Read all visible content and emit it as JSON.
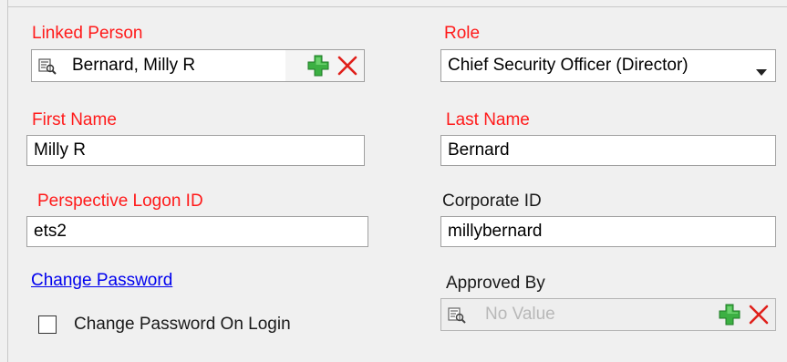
{
  "linked_person": {
    "label": "Linked Person",
    "value": "Bernard, Milly R",
    "add_icon": "green-plus-icon",
    "remove_icon": "red-x-icon",
    "lookup_icon": "lookup-list-icon"
  },
  "role": {
    "label": "Role",
    "selected": "Chief Security Officer (Director)"
  },
  "first_name": {
    "label": "First Name",
    "value": "Milly R"
  },
  "last_name": {
    "label": "Last Name",
    "value": "Bernard"
  },
  "logon_id": {
    "label": "Perspective Logon ID",
    "value": "ets2"
  },
  "corporate_id": {
    "label": "Corporate ID",
    "value": "millybernard"
  },
  "change_password": {
    "label": "Change Password"
  },
  "change_password_on_login": {
    "label": "Change Password On Login",
    "checked": false
  },
  "approved_by": {
    "label": "Approved By",
    "placeholder": "No Value"
  },
  "colors": {
    "required_label": "#ff1a1a",
    "link": "#0000ee",
    "plus_green": "#3cb043",
    "x_red": "#e0201b"
  }
}
